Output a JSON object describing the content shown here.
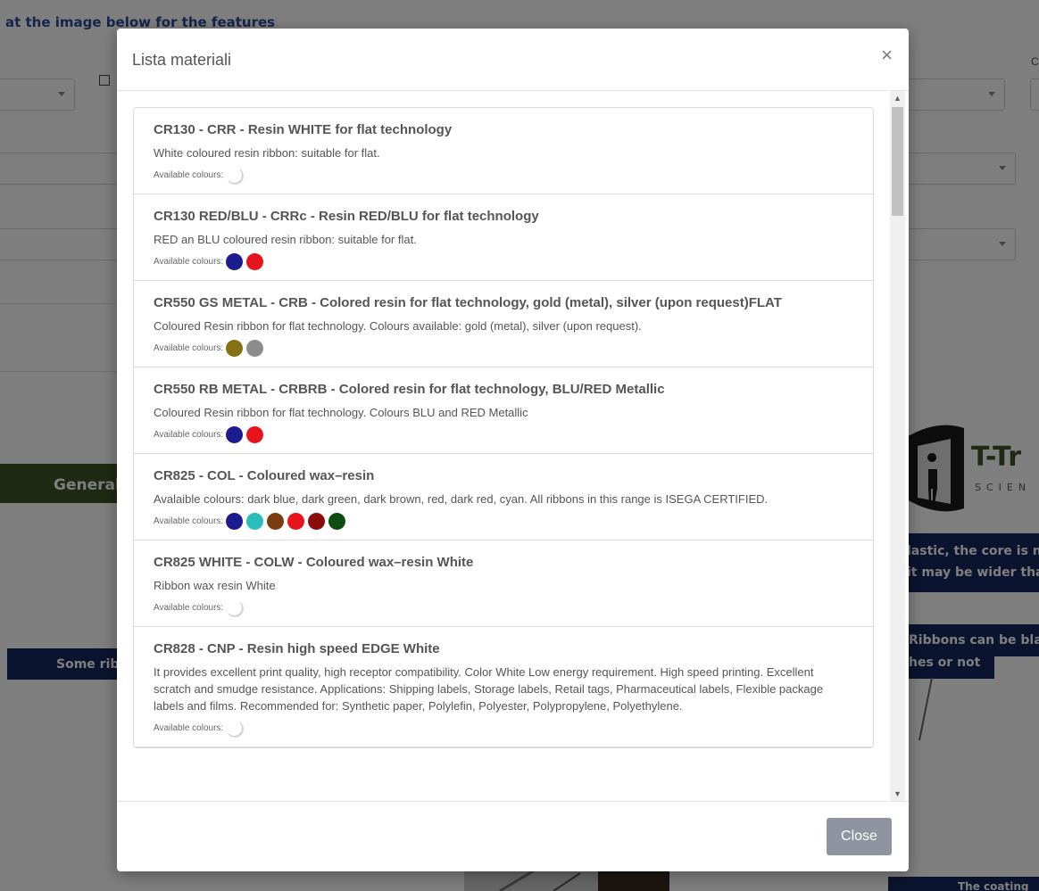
{
  "background": {
    "heading": "at the image below for the features",
    "green_bar_text": "General",
    "navy_bar_left_text": "Some ribb",
    "logo_text_top": "T-Tr",
    "logo_text_bottom": "SCIEN",
    "right_bar_1_line_1": "lastic, the core is nor",
    "right_bar_1_line_2": "it may be wider tha",
    "right_bar_2": "Ribbons can be black",
    "right_bar_3": "hes or not",
    "bottom_bar": "The coating",
    "corner_label": "C"
  },
  "modal": {
    "title": "Lista materiali",
    "close_x": "×",
    "close_button_label": "Close",
    "colours_label": "Available colours:",
    "items": [
      {
        "title": "CR130 - CRR - Resin WHITE for flat technology",
        "description": "White coloured resin ribbon: suitable for flat.",
        "colours": [
          "#ffffff"
        ]
      },
      {
        "title": "CR130 RED/BLU - CRRc - Resin RED/BLU for flat technology",
        "description": "RED an BLU coloured resin ribbon: suitable for flat.",
        "colours": [
          "#1c1c8f",
          "#e8141b"
        ]
      },
      {
        "title": "CR550 GS METAL - CRB - Colored resin for flat technology, gold (metal), silver (upon request)FLAT",
        "description": "Coloured Resin ribbon for flat technology. Colours available: gold (metal), silver (upon request).",
        "colours": [
          "#857214",
          "#8c8c8c"
        ]
      },
      {
        "title": "CR550 RB METAL - CRBRB - Colored resin for flat technology, BLU/RED Metallic",
        "description": "Coloured Resin ribbon for flat technology. Colours BLU and RED Metallic",
        "colours": [
          "#1c1c8f",
          "#e8141b"
        ]
      },
      {
        "title": "CR825 - COL - Coloured wax–resin",
        "description": "Avalaible colours: dark blue, dark green, dark brown, red, dark red, cyan. All ribbons in this range is ISEGA CERTIFIED.",
        "colours": [
          "#1c1c8f",
          "#2bbcbc",
          "#7a3d10",
          "#e8141b",
          "#8b0c0c",
          "#0d4d12"
        ]
      },
      {
        "title": "CR825 WHITE - COLW - Coloured wax–resin White",
        "description": "Ribbon wax resin White",
        "colours": [
          "#ffffff"
        ]
      },
      {
        "title": "CR828 - CNP - Resin high speed EDGE White",
        "description": "It provides excellent print quality, high receptor compatibility. Color White Low energy requirement. High speed printing. Excellent scratch and smudge resistance. Applications: Shipping labels, Storage labels, Retail tags, Pharmaceutical labels, Flexible package labels and films. Recommended for: Synthetic paper, Polylefin, Polyester, Polypropylene, Polyethylene.",
        "colours": [
          "#ffffff"
        ]
      }
    ]
  }
}
